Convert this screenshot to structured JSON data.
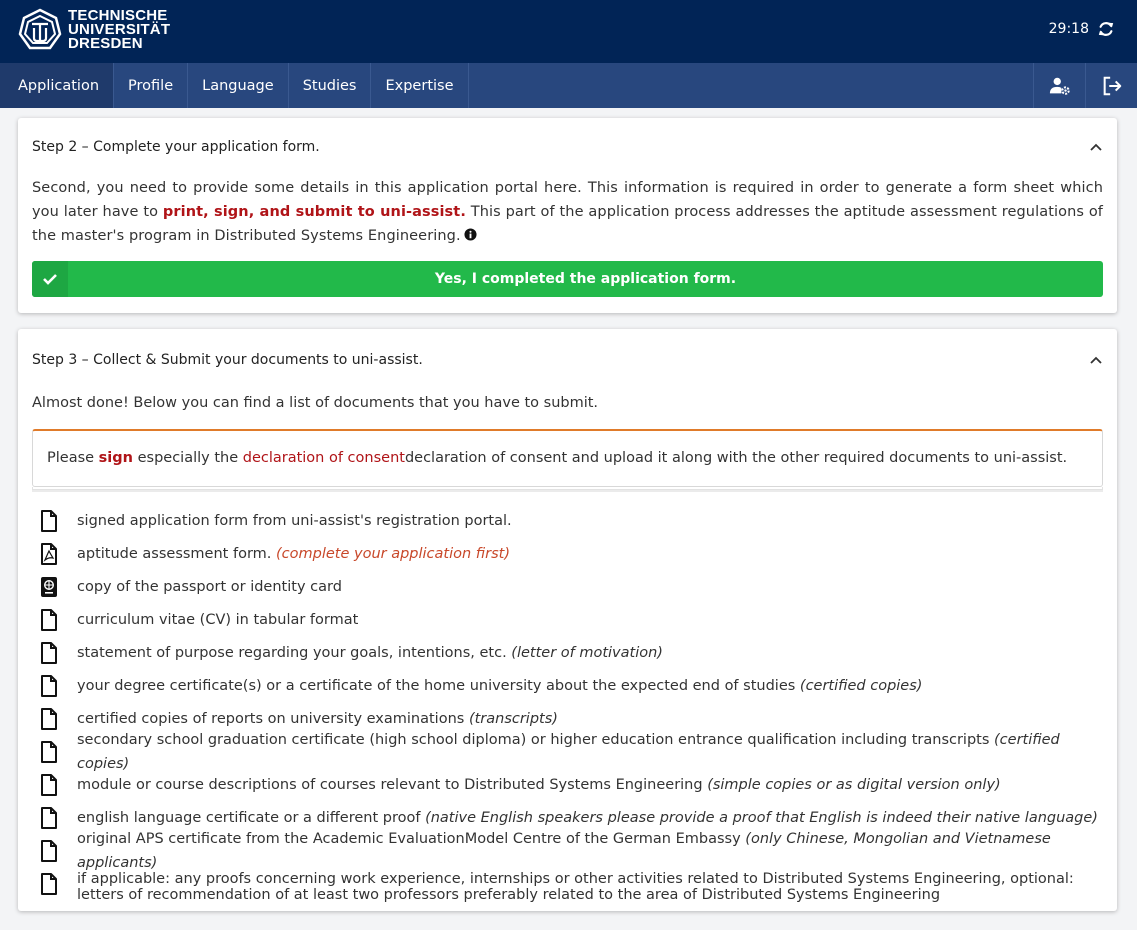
{
  "header": {
    "logo_lines": [
      "TECHNISCHE",
      "UNIVERSITÄT",
      "DRESDEN"
    ],
    "timer": "29:18",
    "refresh_icon": "refresh-icon"
  },
  "nav": {
    "items": [
      "Application",
      "Profile",
      "Language",
      "Studies",
      "Expertise"
    ],
    "active": "Application",
    "icons": [
      "user-settings-icon",
      "logout-icon"
    ]
  },
  "step2": {
    "title": "Step 2 – Complete your application form.",
    "text_before": "Second, you need to provide some details in this application portal here. This information is required in order to generate a form sheet which you later have to ",
    "text_highlight": "print, sign, and submit to uni-assist.",
    "text_after": " This part of the application process addresses the aptitude assessment regulations of the master's program in Distributed Systems Engineering.",
    "button_label": "Yes, I completed the application form."
  },
  "step3": {
    "title": "Step 3 – Collect & Submit your documents to uni-assist.",
    "intro": "Almost done! Below you can find a list of documents that you have to submit.",
    "alert": {
      "please": "Please ",
      "sign": "sign",
      "especially": " especially the ",
      "link": "declaration of consent",
      "rest": "declaration of consent and upload it along with the other required documents to uni-assist."
    },
    "documents": [
      {
        "icon": "file-icon",
        "text": "signed application form from uni-assist's registration portal.",
        "note": ""
      },
      {
        "icon": "pdf-file-icon",
        "text": "aptitude assessment form. ",
        "note": "(complete your application first)"
      },
      {
        "icon": "passport-icon",
        "text": "copy of the passport or identity card",
        "note": ""
      },
      {
        "icon": "file-icon",
        "text": "curriculum vitae (CV) in tabular format",
        "note": ""
      },
      {
        "icon": "file-icon",
        "text": "statement of purpose regarding your goals, intentions, etc. ",
        "note": "(letter of motivation)"
      },
      {
        "icon": "file-icon",
        "text": "your degree certificate(s) or a certificate of the home university about the expected end of studies ",
        "note": "(certified copies)"
      },
      {
        "icon": "file-icon",
        "text": "certified copies of reports on university examinations ",
        "note": "(transcripts)"
      },
      {
        "icon": "file-icon",
        "text": "secondary school graduation certificate (high school diploma) or higher education entrance qualification including transcripts ",
        "note": "(certified copies)"
      },
      {
        "icon": "file-icon",
        "text": "module or course descriptions of courses relevant to Distributed Systems Engineering ",
        "note": "(simple copies or as digital version only)"
      },
      {
        "icon": "file-icon",
        "text": "english language certificate or a different proof ",
        "note": "(native English speakers please provide a proof that English is indeed their native language)"
      },
      {
        "icon": "file-icon",
        "text": "original APS certificate from the Academic EvaluationModel Centre of the German Embassy ",
        "note": "(only Chinese, Mongolian and Vietnamese applicants)"
      },
      {
        "icon": "file-icon",
        "text": "if applicable: any proofs concerning work experience, internships or other activities related to Distributed Systems Engineering, optional: letters of recommendation of at least two professors preferably related to the area of Distributed Systems Engineering",
        "note": ""
      }
    ]
  },
  "colors": {
    "header_bg": "#012456",
    "nav_bg": "#28477e",
    "success": "#22b94a",
    "highlight_red": "#b01418",
    "hint_orange": "#c8482a",
    "alert_border": "#e07b2a"
  }
}
